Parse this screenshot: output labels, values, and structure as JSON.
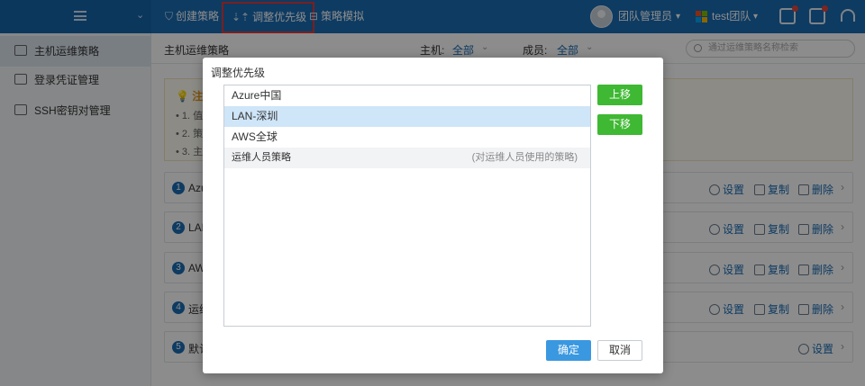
{
  "topbar": {
    "create_label": "创建策略",
    "priority_label": "调整优先级",
    "simulate_label": "策略模拟",
    "user_label": "团队管理员",
    "team_label": "test团队"
  },
  "sidebar": {
    "items": [
      {
        "label": "主机运维策略",
        "active": true
      },
      {
        "label": "登录凭证管理",
        "active": false
      },
      {
        "label": "SSH密钥对管理",
        "active": false
      }
    ]
  },
  "main": {
    "breadcrumb": "主机运维策略",
    "host_filter_label": "主机:",
    "host_filter_value": "全部",
    "member_filter_label": "成员:",
    "member_filter_value": "全部",
    "search_placeholder": "通过运维策略名称检索",
    "notice": {
      "title": "注",
      "lines": [
        "• 1. 值",
        "• 2. 策",
        "• 3. 主"
      ]
    },
    "policies": [
      {
        "num": "1",
        "name": "Azu"
      },
      {
        "num": "2",
        "name": "LAN"
      },
      {
        "num": "3",
        "name": "AW"
      },
      {
        "num": "4",
        "name": "运维"
      },
      {
        "num": "5",
        "name": "默认"
      }
    ],
    "actions": {
      "settings": "设置",
      "copy": "复制",
      "delete": "删除"
    }
  },
  "modal": {
    "title": "调整优先级",
    "list": [
      {
        "label": "Azure中国",
        "selected": false
      },
      {
        "label": "LAN-深圳",
        "selected": true
      },
      {
        "label": "AWS全球",
        "selected": false
      }
    ],
    "group": {
      "label": "运维人员策略",
      "note": "(对运维人员使用的策略)"
    },
    "up_label": "上移",
    "down_label": "下移",
    "ok_label": "确定",
    "cancel_label": "取消"
  },
  "colors": {
    "topbar": "#1a6cb3",
    "primary": "#3a98e0",
    "move_button": "#3fb833",
    "selected_row": "#cfe5f8",
    "highlight_border": "#e03a3a"
  }
}
